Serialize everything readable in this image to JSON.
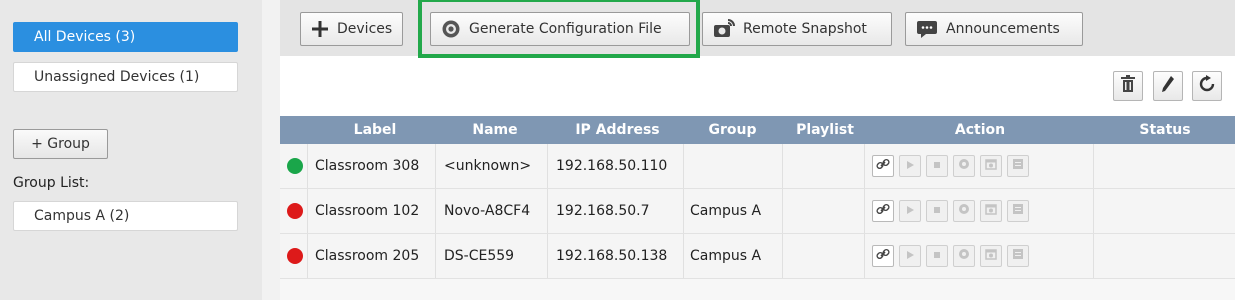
{
  "sidebar": {
    "all_devices": "All Devices (3)",
    "unassigned": "Unassigned Devices (1)",
    "group_button": "+ Group",
    "group_list_label": "Group List:",
    "groups": [
      {
        "label": "Campus A (2)"
      }
    ]
  },
  "toolbar": {
    "devices": "Devices",
    "generate_config": "Generate Configuration File",
    "remote_snapshot": "Remote Snapshot",
    "announcements": "Announcements"
  },
  "table": {
    "columns": [
      "Label",
      "Name",
      "IP Address",
      "Group",
      "Playlist",
      "Action",
      "Status"
    ],
    "rows": [
      {
        "status_color": "#1aa64a",
        "label": "Classroom 308",
        "name": "<unknown>",
        "ip": "192.168.50.110",
        "group": "",
        "playlist": "",
        "status": ""
      },
      {
        "status_color": "#dd1a1a",
        "label": "Classroom 102",
        "name": "Novo-A8CF4",
        "ip": "192.168.50.7",
        "group": "Campus A",
        "playlist": "",
        "status": ""
      },
      {
        "status_color": "#dd1a1a",
        "label": "Classroom 205",
        "name": "DS-CE559",
        "ip": "192.168.50.138",
        "group": "Campus A",
        "playlist": "",
        "status": ""
      }
    ]
  },
  "colors": {
    "accent": "#2b8fe0",
    "header": "#7f97b3",
    "highlight": "#22a84a",
    "online": "#1aa64a",
    "offline": "#dd1a1a"
  },
  "icons": [
    "plus-icon",
    "gear-icon",
    "camera-icon",
    "chat-icon",
    "trash-icon",
    "pencil-icon",
    "refresh-icon",
    "link-icon",
    "play-icon",
    "stop-icon",
    "settings-icon",
    "schedule-icon",
    "list-icon"
  ]
}
